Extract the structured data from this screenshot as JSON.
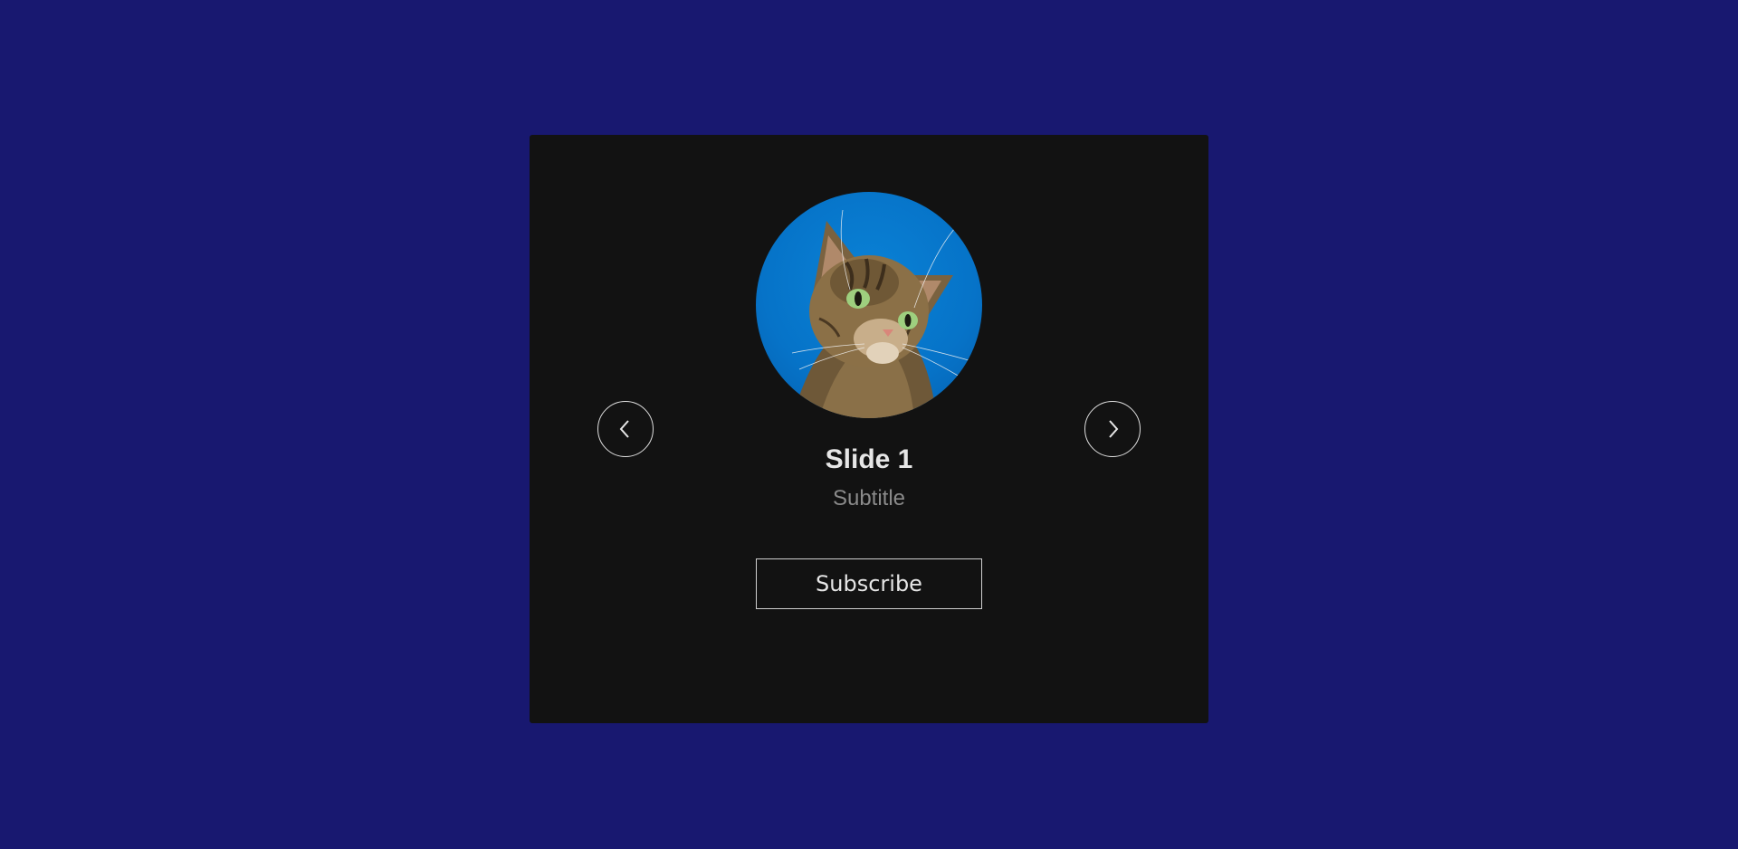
{
  "colors": {
    "page_background": "#181870",
    "card_background": "#121212",
    "avatar_background": "#0673c8",
    "title_color": "#e6e6e6",
    "subtitle_color": "#8a8a8a",
    "border_color": "#cfcfcf"
  },
  "slide": {
    "image_subject": "tabby cat looking up against blue sky",
    "title": "Slide 1",
    "subtitle": "Subtitle",
    "cta_label": "Subscribe"
  },
  "navigation": {
    "prev_icon": "chevron-left-icon",
    "next_icon": "chevron-right-icon"
  }
}
